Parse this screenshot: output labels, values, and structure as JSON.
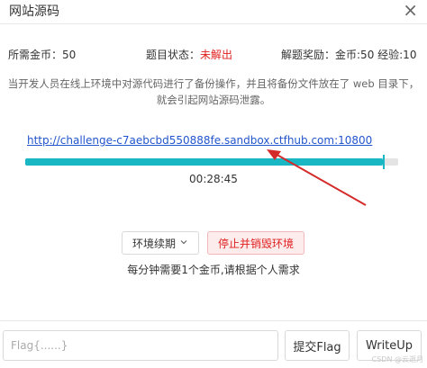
{
  "dialog": {
    "title": "网站源码",
    "close_symbol": "×"
  },
  "info": {
    "coins_label": "所需金币：",
    "coins_value": "50",
    "status_label": "题目状态：",
    "status_value": "未解出",
    "reward_label": "解题奖励：",
    "reward_value": "金币:50 经验:10"
  },
  "description": {
    "line1": "当开发人员在线上环境中对源代码进行了备份操作，并且将备份文件放在了 web 目录下，",
    "line2": "就会引起网站源码泄露。"
  },
  "environment": {
    "url": "http://challenge-c7aebcbd550888fe.sandbox.ctfhub.com:10800",
    "remaining_fraction": 0.96,
    "timer": "00:28:45",
    "renew_label": "环境续期",
    "stop_label": "停止并销毁环境",
    "hint": "每分钟需要1个金币,请根据个人需求"
  },
  "footer": {
    "flag_placeholder": "Flag{......}",
    "submit_label": "提交Flag",
    "writeup_label": "WriteUp"
  },
  "watermark": "CSDN @云逝月",
  "colors": {
    "accent": "#19b6c4",
    "danger": "#e02020",
    "link": "#2255cc",
    "arrow": "#d42a2a"
  }
}
